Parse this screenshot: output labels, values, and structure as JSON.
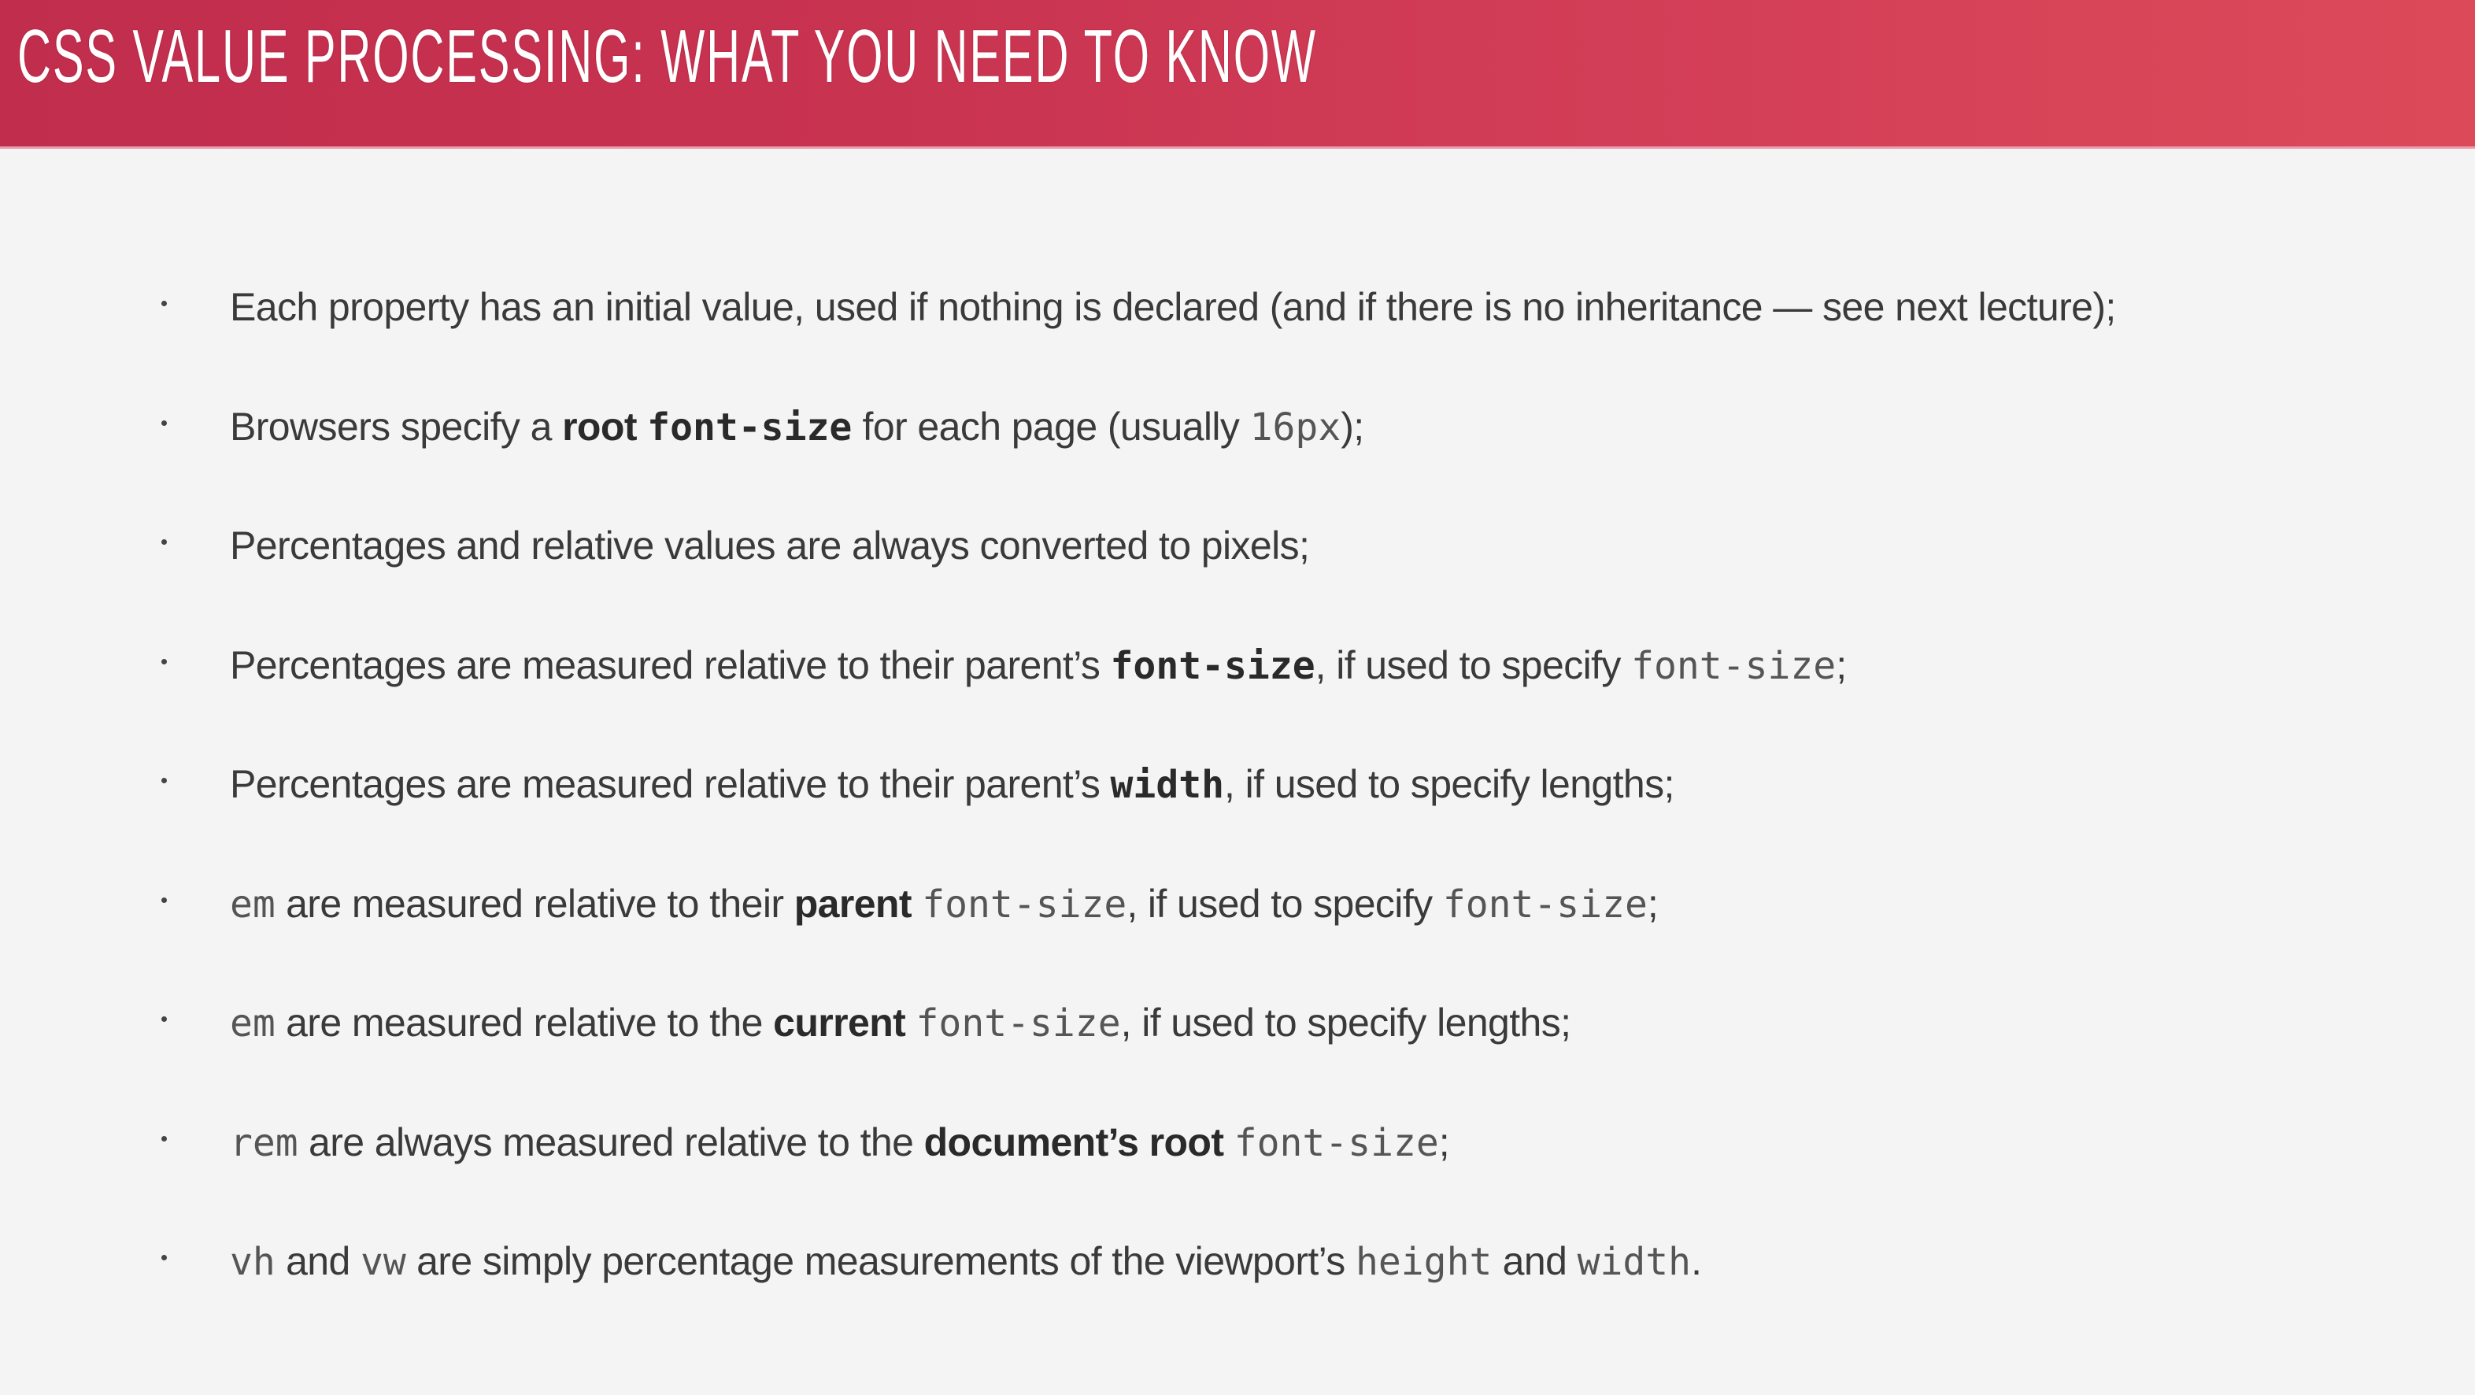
{
  "header": {
    "title": "CSS VALUE PROCESSING: WHAT YOU NEED TO KNOW"
  },
  "bullets": [
    [
      {
        "t": "Each property has an initial value, used if nothing is declared (and if there is no inheritance — see next lecture);",
        "s": "normal"
      }
    ],
    [
      {
        "t": "Browsers specify a ",
        "s": "normal"
      },
      {
        "t": "root ",
        "s": "bold"
      },
      {
        "t": "font-size",
        "s": "codebold"
      },
      {
        "t": " for each page (usually ",
        "s": "normal"
      },
      {
        "t": "16px",
        "s": "code"
      },
      {
        "t": ");",
        "s": "normal"
      }
    ],
    [
      {
        "t": "Percentages and relative values are always converted to pixels;",
        "s": "normal"
      }
    ],
    [
      {
        "t": "Percentages are measured relative to their parent’s ",
        "s": "normal"
      },
      {
        "t": "font-size",
        "s": "codebold"
      },
      {
        "t": ", if used to specify ",
        "s": "normal"
      },
      {
        "t": "font-size",
        "s": "code"
      },
      {
        "t": ";",
        "s": "normal"
      }
    ],
    [
      {
        "t": "Percentages are measured relative to their parent’s ",
        "s": "normal"
      },
      {
        "t": "width",
        "s": "codebold"
      },
      {
        "t": ", if used to specify lengths;",
        "s": "normal"
      }
    ],
    [
      {
        "t": "em",
        "s": "code"
      },
      {
        "t": " are measured relative to their ",
        "s": "normal"
      },
      {
        "t": "parent",
        "s": "bold"
      },
      {
        "t": " ",
        "s": "normal"
      },
      {
        "t": "font-size",
        "s": "code"
      },
      {
        "t": ", if used to specify ",
        "s": "normal"
      },
      {
        "t": "font-size",
        "s": "code"
      },
      {
        "t": ";",
        "s": "normal"
      }
    ],
    [
      {
        "t": "em",
        "s": "code"
      },
      {
        "t": " are measured relative to the ",
        "s": "normal"
      },
      {
        "t": "current",
        "s": "bold"
      },
      {
        "t": " ",
        "s": "normal"
      },
      {
        "t": "font-size",
        "s": "code"
      },
      {
        "t": ", if used to specify lengths;",
        "s": "normal"
      }
    ],
    [
      {
        "t": "rem",
        "s": "code"
      },
      {
        "t": " are always measured relative to the ",
        "s": "normal"
      },
      {
        "t": "document’s root",
        "s": "bold"
      },
      {
        "t": " ",
        "s": "normal"
      },
      {
        "t": "font-size",
        "s": "code"
      },
      {
        "t": ";",
        "s": "normal"
      }
    ],
    [
      {
        "t": "vh",
        "s": "code"
      },
      {
        "t": " and ",
        "s": "normal"
      },
      {
        "t": "vw",
        "s": "code"
      },
      {
        "t": " are simply percentage measurements of the viewport’s ",
        "s": "normal"
      },
      {
        "t": "height",
        "s": "code"
      },
      {
        "t": " and ",
        "s": "normal"
      },
      {
        "t": "width",
        "s": "code"
      },
      {
        "t": ".",
        "s": "normal"
      }
    ]
  ]
}
